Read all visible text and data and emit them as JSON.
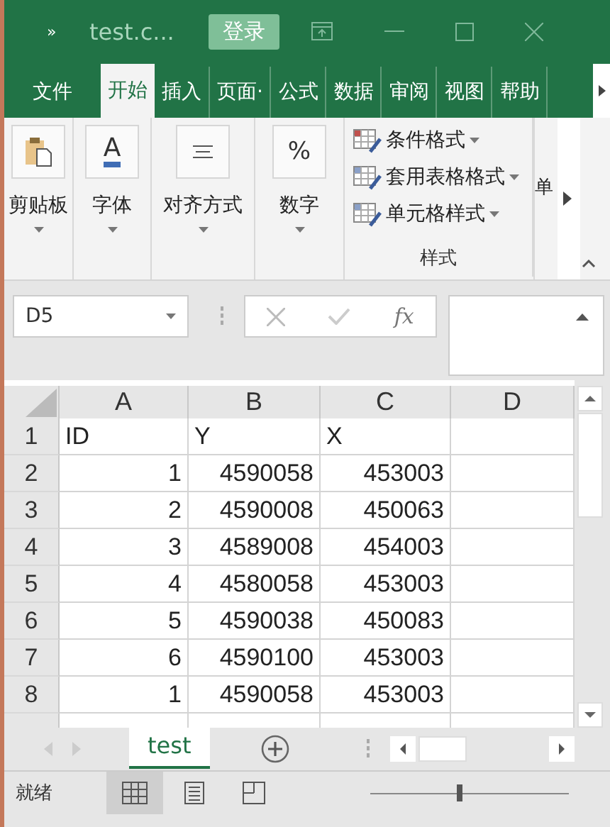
{
  "title_bar": {
    "more": "»",
    "title": "test.c...",
    "login": "登录"
  },
  "tabs": [
    {
      "label": "文件",
      "selected": false
    },
    {
      "label": "开始",
      "selected": true
    },
    {
      "label": "插入",
      "selected": false
    },
    {
      "label": "页面·",
      "selected": false
    },
    {
      "label": "公式",
      "selected": false
    },
    {
      "label": "数据",
      "selected": false
    },
    {
      "label": "审阅",
      "selected": false
    },
    {
      "label": "视图",
      "selected": false
    },
    {
      "label": "帮助",
      "selected": false
    }
  ],
  "ribbon": {
    "groups": [
      {
        "kind": "clipboard",
        "label": "剪贴板"
      },
      {
        "kind": "font",
        "label": "字体",
        "glyph": "A"
      },
      {
        "kind": "align",
        "label": "对齐方式"
      },
      {
        "kind": "number",
        "label": "数字",
        "glyph": "%"
      }
    ],
    "styles": {
      "items": [
        "条件格式",
        "套用表格格式",
        "单元格样式"
      ],
      "label": "样式"
    },
    "cut_group": "单"
  },
  "formula_bar": {
    "name_box": "D5",
    "fx": "fx"
  },
  "grid": {
    "columns": [
      "A",
      "B",
      "C",
      "D"
    ],
    "rows": [
      {
        "header": "1",
        "kind": "text",
        "cells": [
          "ID",
          "Y",
          "X"
        ]
      },
      {
        "header": "2",
        "kind": "number",
        "cells": [
          "1",
          "4590058",
          "453003"
        ]
      },
      {
        "header": "3",
        "kind": "number",
        "cells": [
          "2",
          "4590008",
          "450063"
        ]
      },
      {
        "header": "4",
        "kind": "number",
        "cells": [
          "3",
          "4589008",
          "454003"
        ]
      },
      {
        "header": "5",
        "kind": "number",
        "cells": [
          "4",
          "4580058",
          "453003"
        ]
      },
      {
        "header": "6",
        "kind": "number",
        "cells": [
          "5",
          "4590038",
          "450083"
        ]
      },
      {
        "header": "7",
        "kind": "number",
        "cells": [
          "6",
          "4590100",
          "453003"
        ]
      },
      {
        "header": "8",
        "kind": "number",
        "cells": [
          "1",
          "4590058",
          "453003"
        ]
      }
    ]
  },
  "sheet_tabs": [
    {
      "label": "test",
      "selected": true
    }
  ],
  "status_bar": {
    "text": "就绪",
    "views": [
      {
        "kind": "normal",
        "selected": true
      },
      {
        "kind": "page",
        "selected": false
      },
      {
        "kind": "break",
        "selected": false
      }
    ],
    "zoom": {
      "level": 0.45
    }
  }
}
